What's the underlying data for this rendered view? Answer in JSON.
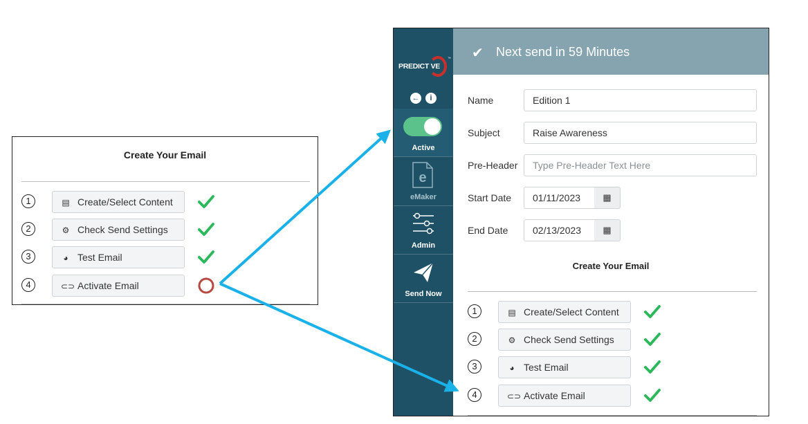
{
  "callout": {
    "title": "Create Your Email",
    "steps": [
      {
        "num": "1",
        "label": "Create/Select Content",
        "icon": "file-icon",
        "status": "done"
      },
      {
        "num": "2",
        "label": "Check Send Settings",
        "icon": "gear-icon",
        "status": "done"
      },
      {
        "num": "3",
        "label": "Test Email",
        "icon": "globe-icon",
        "status": "done"
      },
      {
        "num": "4",
        "label": "Activate Email",
        "icon": "toggle-icon",
        "status": "pending"
      }
    ]
  },
  "app": {
    "logo_text": "PREDICT VE",
    "trademark": "™",
    "sidebar": {
      "back_icon": "back-arrow-icon",
      "info_icon": "info-icon",
      "items": [
        {
          "label": "Active",
          "icon": "toggle-switch",
          "toggle_on": true
        },
        {
          "label": "eMaker",
          "icon": "emaker-document-icon"
        },
        {
          "label": "Admin",
          "icon": "sliders-icon"
        },
        {
          "label": "Send Now",
          "icon": "paper-plane-icon"
        }
      ]
    },
    "banner": {
      "text": "Next send in 59 Minutes",
      "icon": "check-icon"
    },
    "form": {
      "name": {
        "label": "Name",
        "value": "Edition 1"
      },
      "subject": {
        "label": "Subject",
        "value": "Raise Awareness"
      },
      "preheader": {
        "label": "Pre-Header",
        "value": "",
        "placeholder": "Type Pre-Header Text Here"
      },
      "start_date": {
        "label": "Start Date",
        "value": "01/11/2023"
      },
      "end_date": {
        "label": "End Date",
        "value": "02/13/2023"
      }
    },
    "create_title": "Create Your Email",
    "steps": [
      {
        "num": "1",
        "label": "Create/Select Content",
        "icon": "file-icon",
        "status": "done"
      },
      {
        "num": "2",
        "label": "Check Send Settings",
        "icon": "gear-icon",
        "status": "done"
      },
      {
        "num": "3",
        "label": "Test Email",
        "icon": "globe-icon",
        "status": "done"
      },
      {
        "num": "4",
        "label": "Activate Email",
        "icon": "toggle-icon",
        "status": "done"
      }
    ]
  },
  "colors": {
    "sidebar": "#1f5166",
    "banner": "#86a4b0",
    "toggle_on": "#5cc28c",
    "check": "#2eb85c",
    "pending_circle": "#b5493f",
    "arrow": "#1ab0e8"
  }
}
